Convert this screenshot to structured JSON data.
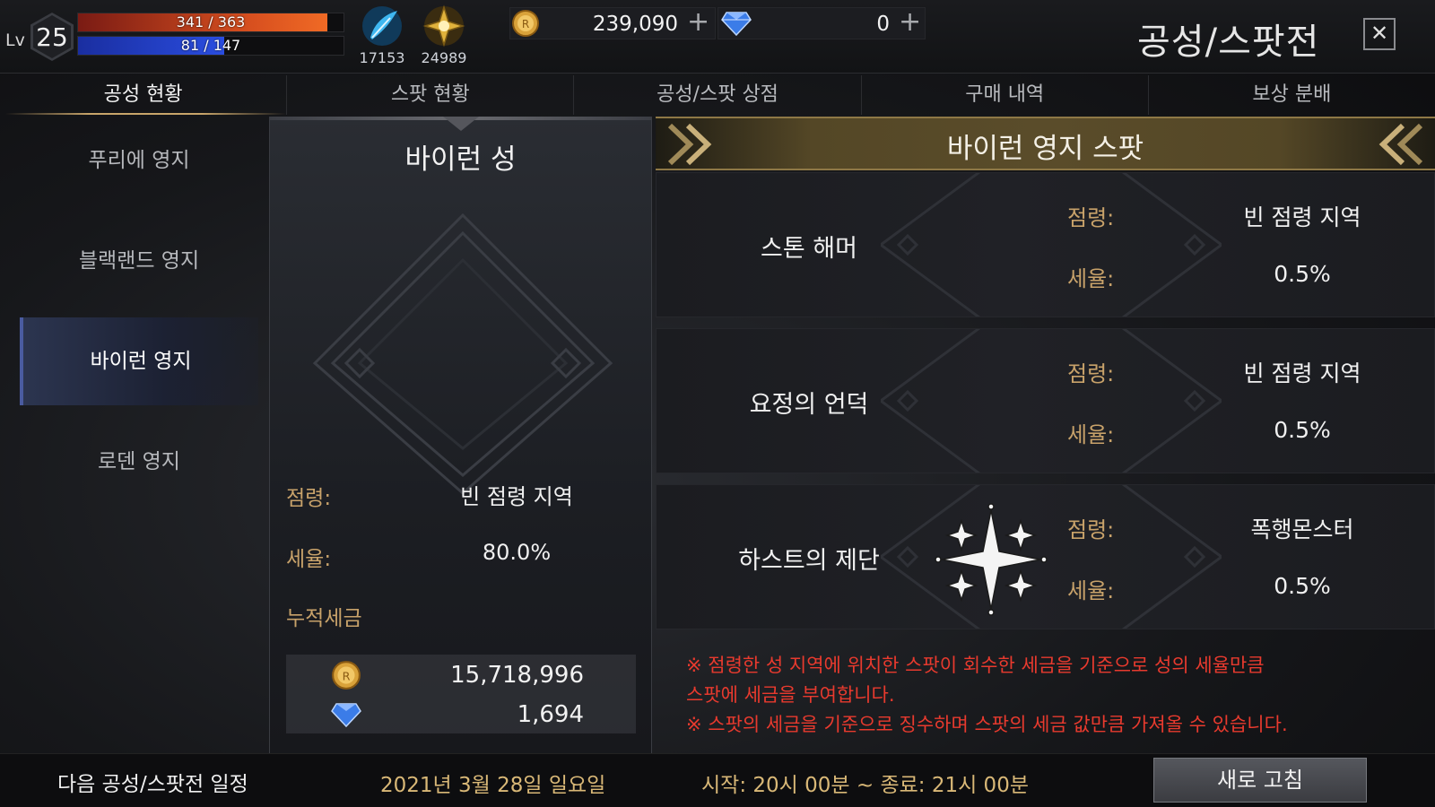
{
  "player": {
    "lv_label": "Lv",
    "level": "25",
    "hp_text": "341 / 363",
    "hp_fraction": 0.939,
    "mp_text": "81 / 147",
    "mp_fraction": 0.551
  },
  "resources": {
    "feather_count": "17153",
    "emblem_count": "24989",
    "gold": "239,090",
    "gems": "0"
  },
  "window": {
    "title": "공성/스팟전",
    "close_label": "✕"
  },
  "tabs": [
    {
      "label": "공성 현황",
      "active": true
    },
    {
      "label": "스팟 현황",
      "active": false
    },
    {
      "label": "공성/스팟 상점",
      "active": false
    },
    {
      "label": "구매 내역",
      "active": false
    },
    {
      "label": "보상 분배",
      "active": false
    }
  ],
  "territories": [
    {
      "label": "푸리에 영지",
      "active": false
    },
    {
      "label": "블랙랜드 영지",
      "active": false
    },
    {
      "label": "바이런 영지",
      "active": true
    },
    {
      "label": "로덴 영지",
      "active": false
    }
  ],
  "castle": {
    "name": "바이런 성",
    "occupy_label": "점령:",
    "occupy_value": "빈 점령 지역",
    "tax_label": "세율:",
    "tax_value": "80.0%",
    "accum_label": "누적세금",
    "gold_total": "15,718,996",
    "gem_total": "1,694"
  },
  "spot_panel": {
    "title": "바이런 영지 스팟",
    "spots": [
      {
        "name": "스톤 해머",
        "occupy_label": "점령:",
        "occupy_value": "빈 점령 지역",
        "tax_label": "세율:",
        "tax_value": "0.5%",
        "has_emblem": false
      },
      {
        "name": "요정의 언덕",
        "occupy_label": "점령:",
        "occupy_value": "빈 점령 지역",
        "tax_label": "세율:",
        "tax_value": "0.5%",
        "has_emblem": false
      },
      {
        "name": "하스트의 제단",
        "occupy_label": "점령:",
        "occupy_value": "폭행몬스터",
        "tax_label": "세율:",
        "tax_value": "0.5%",
        "has_emblem": true
      }
    ],
    "notice_line1": "※ 점령한 성 지역에 위치한 스팟이 회수한 세금을 기준으로 성의 세율만큼",
    "notice_line2": "스팟에 세금을 부여합니다.",
    "notice_line3": "※ 스팟의 세금을 기준으로 징수하며 스팟의 세금 값만큼 가져올 수 있습니다."
  },
  "footer": {
    "label": "다음 공성/스팟전 일정",
    "date": "2021년 3월 28일 일요일",
    "time": "시작: 20시 00분 ~ 종료: 21시 00분",
    "refresh_label": "새로 고침"
  },
  "colors": {
    "accent_gold": "#c8a26a",
    "notice_red": "#e83a2e",
    "hp": "#d8501f",
    "mp": "#2a4de0"
  }
}
